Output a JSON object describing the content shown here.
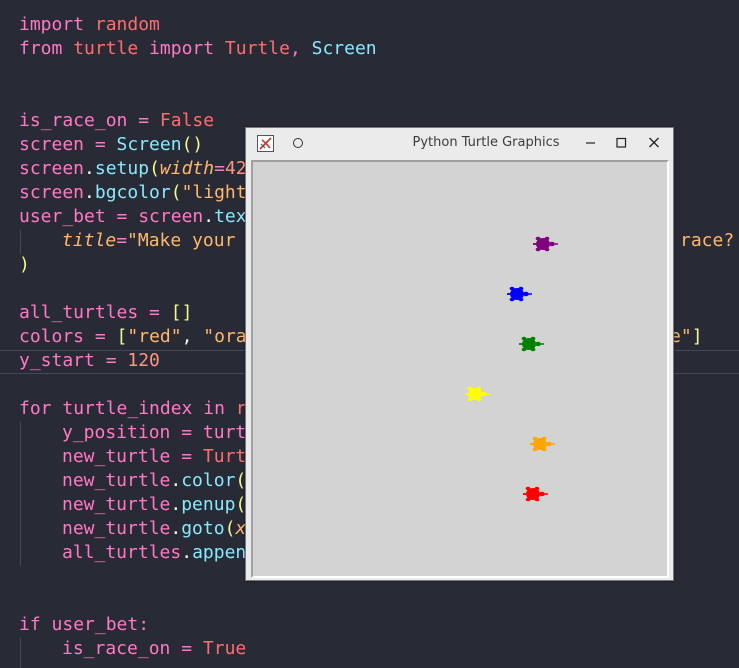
{
  "editor": {
    "lines": {
      "l1": {
        "kw": "import",
        "mod": " random"
      },
      "l2": {
        "kw1": "from",
        "mod": " turtle",
        "kw2": " import",
        "cls": " Turtle",
        "comma": ",",
        "fn": " Screen"
      },
      "l4": {
        "var": "is_race_on",
        "op": " = ",
        "cst": "False"
      },
      "l5": {
        "var": "screen",
        "op": " = ",
        "fn": "Screen",
        "brk": "()"
      },
      "l6": {
        "var": "screen",
        "dot": ".",
        "fn": "setup",
        "brk": "(",
        "prm": "width",
        "op": "=",
        "num": "42"
      },
      "l7": {
        "var": "screen",
        "dot": ".",
        "fn": "bgcolor",
        "brk": "(",
        "str": "\"light"
      },
      "l8": {
        "var": "user_bet",
        "op": " = ",
        "var2": "screen",
        "dot": ".",
        "fn": "tex"
      },
      "l9": {
        "prm": "title",
        "op": "=",
        "str": "\"Make your",
        "str2": "race?"
      },
      "l10": {
        "brk": ")"
      },
      "l12": {
        "var": "all_turtles",
        "op": " = ",
        "brk": "[]"
      },
      "l13": {
        "var": "colors",
        "op": " = ",
        "brk": "[",
        "str": "\"red\"",
        "comma": ", ",
        "str2": "\"ora",
        "str3": "e\"",
        "brk2": "]"
      },
      "l14": {
        "var": "y_start",
        "op": " = ",
        "num": "120"
      },
      "l16": {
        "kw": "for",
        "var": " turtle_index",
        "kw2": " in",
        "fn": " r"
      },
      "l17": {
        "var": "y_position",
        "op": " = ",
        "var2": "turt"
      },
      "l18": {
        "var": "new_turtle",
        "op": " = ",
        "cls": "Turt"
      },
      "l19": {
        "var": "new_turtle",
        "dot": ".",
        "fn": "color",
        "brk": "("
      },
      "l20": {
        "var": "new_turtle",
        "dot": ".",
        "fn": "penup",
        "brk": "("
      },
      "l21": {
        "var": "new_turtle",
        "dot": ".",
        "fn": "goto",
        "brk": "(",
        "prm": "x"
      },
      "l22": {
        "var": "all_turtles",
        "dot": ".",
        "fn": "appen"
      },
      "l25": {
        "kw": "if",
        "var": " user_bet",
        "op": ":"
      },
      "l26": {
        "var": "is_race_on",
        "op": " = ",
        "cst": "True"
      }
    }
  },
  "window": {
    "title": "Python Turtle Graphics",
    "canvas_bg": "#d3d3d3",
    "turtles": [
      {
        "color": "#800080",
        "name": "purple"
      },
      {
        "color": "#0000ff",
        "name": "blue"
      },
      {
        "color": "#008000",
        "name": "green"
      },
      {
        "color": "#ffff00",
        "name": "yellow"
      },
      {
        "color": "#ffa500",
        "name": "orange"
      },
      {
        "color": "#ff0000",
        "name": "red"
      }
    ]
  }
}
